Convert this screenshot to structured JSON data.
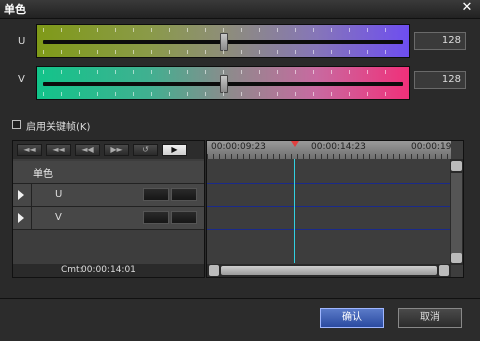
{
  "window": {
    "title": "单色",
    "close_glyph": "✕"
  },
  "channels": [
    {
      "label": "U",
      "value": "128"
    },
    {
      "label": "V",
      "value": "128"
    }
  ],
  "keyframe": {
    "label": "启用关键帧(K)"
  },
  "timeline": {
    "toolbar_buttons": [
      "◄◄",
      "◄◄",
      "◄◀",
      "▶►",
      "↺",
      "▶"
    ],
    "row_title": "单色",
    "tracks": [
      {
        "name": "U"
      },
      {
        "name": "V"
      }
    ],
    "cmt_label": "Cmt:",
    "cmt_value": "00:00:14:01",
    "ruler": [
      "00:00:09:23",
      "00:00:14:23",
      "00:00:19"
    ]
  },
  "buttons": {
    "ok": "确认",
    "cancel": "取消"
  }
}
